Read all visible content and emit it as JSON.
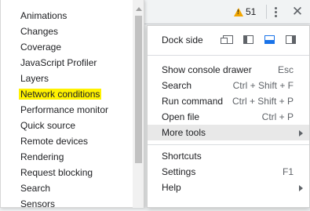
{
  "toolbar": {
    "warning_count": "51",
    "icons": {
      "warning": "warning-triangle-icon",
      "more": "kebab-menu-icon",
      "close": "close-icon"
    }
  },
  "more_tools_submenu": {
    "items": [
      {
        "label": "Animations"
      },
      {
        "label": "Changes"
      },
      {
        "label": "Coverage"
      },
      {
        "label": "JavaScript Profiler"
      },
      {
        "label": "Layers"
      },
      {
        "label": "Network conditions",
        "highlighted": true
      },
      {
        "label": "Performance monitor"
      },
      {
        "label": "Quick source"
      },
      {
        "label": "Remote devices"
      },
      {
        "label": "Rendering"
      },
      {
        "label": "Request blocking"
      },
      {
        "label": "Search"
      },
      {
        "label": "Sensors"
      }
    ],
    "highlight_color": "#fff200"
  },
  "main_menu": {
    "dock_side": {
      "label": "Dock side",
      "options": [
        "undock-into-separate-window-icon",
        "dock-to-left-icon",
        "dock-to-bottom-icon",
        "dock-to-right-icon"
      ],
      "selected": "dock-to-bottom-icon",
      "selected_color": "#1a73e8"
    },
    "items": [
      {
        "label": "Show console drawer",
        "shortcut": "Esc"
      },
      {
        "label": "Search",
        "shortcut": "Ctrl + Shift + F"
      },
      {
        "label": "Run command",
        "shortcut": "Ctrl + Shift + P"
      },
      {
        "label": "Open file",
        "shortcut": "Ctrl + P"
      },
      {
        "label": "More tools",
        "submenu": true,
        "active": true
      }
    ],
    "items_2": [
      {
        "label": "Shortcuts"
      },
      {
        "label": "Settings",
        "shortcut": "F1"
      },
      {
        "label": "Help",
        "submenu": true
      }
    ]
  }
}
